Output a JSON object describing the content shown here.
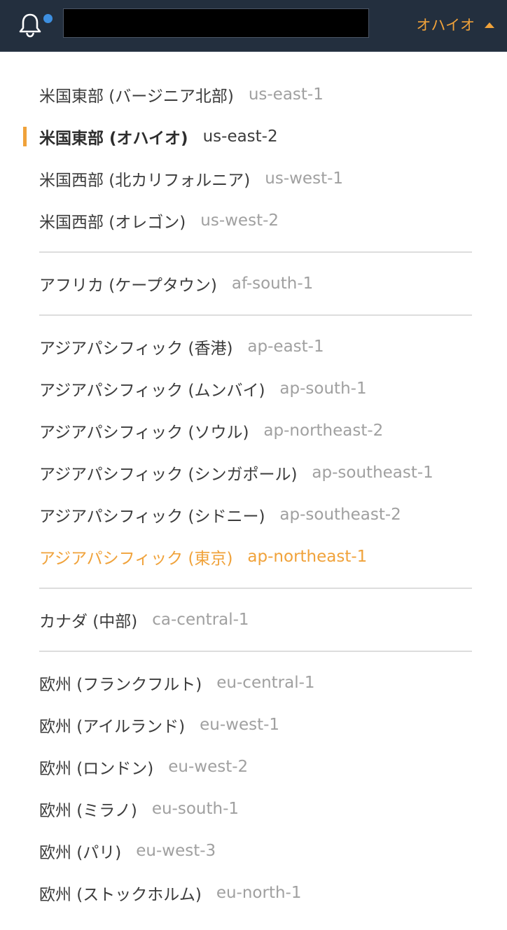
{
  "topbar": {
    "bell_icon": "bell-icon",
    "has_notification": true,
    "search_value": "",
    "region_label": "オハイオ",
    "colors": {
      "bar_bg": "#232f3e",
      "accent": "#f0a23a",
      "notification_dot": "#3d8fe0"
    }
  },
  "regions": {
    "us": [
      {
        "name": "米国東部 (バージニア北部)",
        "code": "us-east-1"
      },
      {
        "name": "米国東部 (オハイオ)",
        "code": "us-east-2"
      },
      {
        "name": "米国西部 (北カリフォルニア)",
        "code": "us-west-1"
      },
      {
        "name": "米国西部 (オレゴン)",
        "code": "us-west-2"
      }
    ],
    "af": [
      {
        "name": "アフリカ (ケープタウン)",
        "code": "af-south-1"
      }
    ],
    "ap": [
      {
        "name": "アジアパシフィック (香港)",
        "code": "ap-east-1"
      },
      {
        "name": "アジアパシフィック (ムンバイ)",
        "code": "ap-south-1"
      },
      {
        "name": "アジアパシフィック (ソウル)",
        "code": "ap-northeast-2"
      },
      {
        "name": "アジアパシフィック (シンガポール)",
        "code": "ap-southeast-1"
      },
      {
        "name": "アジアパシフィック (シドニー)",
        "code": "ap-southeast-2"
      },
      {
        "name": "アジアパシフィック (東京)",
        "code": "ap-northeast-1"
      }
    ],
    "ca": [
      {
        "name": "カナダ (中部)",
        "code": "ca-central-1"
      }
    ],
    "eu": [
      {
        "name": "欧州 (フランクフルト)",
        "code": "eu-central-1"
      },
      {
        "name": "欧州 (アイルランド)",
        "code": "eu-west-1"
      },
      {
        "name": "欧州 (ロンドン)",
        "code": "eu-west-2"
      },
      {
        "name": "欧州 (ミラノ)",
        "code": "eu-south-1"
      },
      {
        "name": "欧州 (パリ)",
        "code": "eu-west-3"
      },
      {
        "name": "欧州 (ストックホルム)",
        "code": "eu-north-1"
      }
    ]
  },
  "selected_region_code": "us-east-2",
  "highlighted_region_code": "ap-northeast-1"
}
